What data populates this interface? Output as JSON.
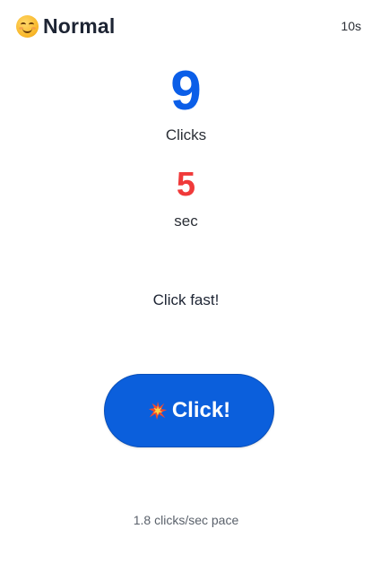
{
  "header": {
    "mode_icon": "smiling-face-icon",
    "mode_label": "Normal",
    "duration": "10s"
  },
  "stats": {
    "clicks_value": "9",
    "clicks_label": "Clicks",
    "time_value": "5",
    "time_label": "sec"
  },
  "prompt": "Click fast!",
  "button": {
    "icon": "collision-icon",
    "label": "Click!"
  },
  "pace": "1.8 clicks/sec pace",
  "colors": {
    "clicks": "#0b5ee8",
    "time": "#f03a3a",
    "button": "#0b5fdc"
  }
}
